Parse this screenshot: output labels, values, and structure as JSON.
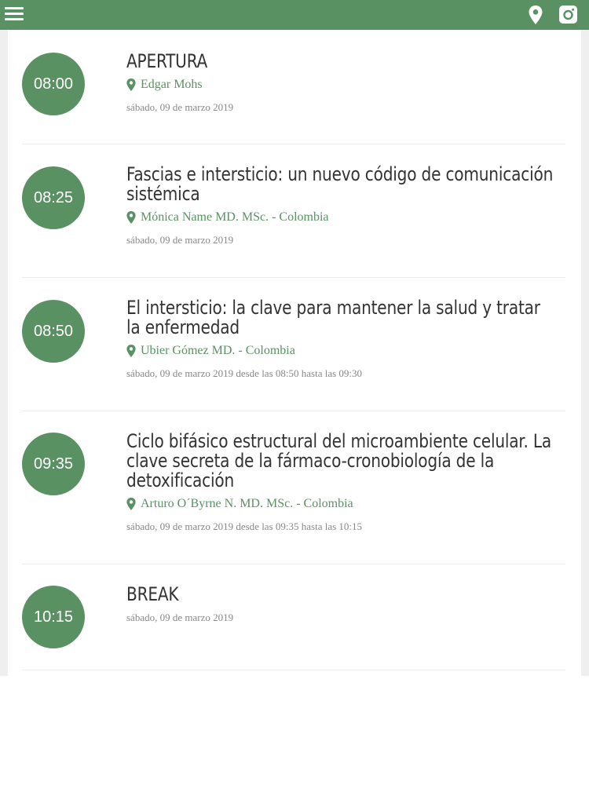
{
  "header": {
    "menu_icon": "hamburger-menu-icon",
    "location_icon": "map-pin-icon",
    "social_icon": "instagram-icon",
    "color": "#5a9163"
  },
  "schedule": [
    {
      "time": "08:00",
      "title_lines": [
        "APERTURA"
      ],
      "speaker": "Edgar Mohs",
      "date": "sábado, 09 de marzo 2019"
    },
    {
      "time": "08:25",
      "title_lines": [
        "Fascias e intersticio: un nuevo código de comunicación",
        "sistémica"
      ],
      "speaker": "Mónica Name MD. MSc. - Colombia",
      "date": "sábado, 09 de marzo 2019"
    },
    {
      "time": "08:50",
      "title_lines": [
        "El intersticio: la clave para mantener la salud y tratar",
        "la enfermedad"
      ],
      "speaker": "Ubier Gómez MD. - Colombia",
      "date": "sábado, 09 de marzo 2019 desde las 08:50 hasta las 09:30"
    },
    {
      "time": "09:35",
      "title_lines": [
        "Ciclo bifásico estructural del microambiente celular. La",
        "clave secreta de la fármaco-cronobiología de la",
        "detoxificación"
      ],
      "speaker": "Arturo O´Byrne N. MD. MSc. - Colombia",
      "date": "sábado, 09 de marzo 2019 desde las 09:35 hasta las 10:15"
    },
    {
      "time": "10:15",
      "title_lines": [
        "BREAK"
      ],
      "date": "sábado, 09 de marzo 2019"
    }
  ]
}
